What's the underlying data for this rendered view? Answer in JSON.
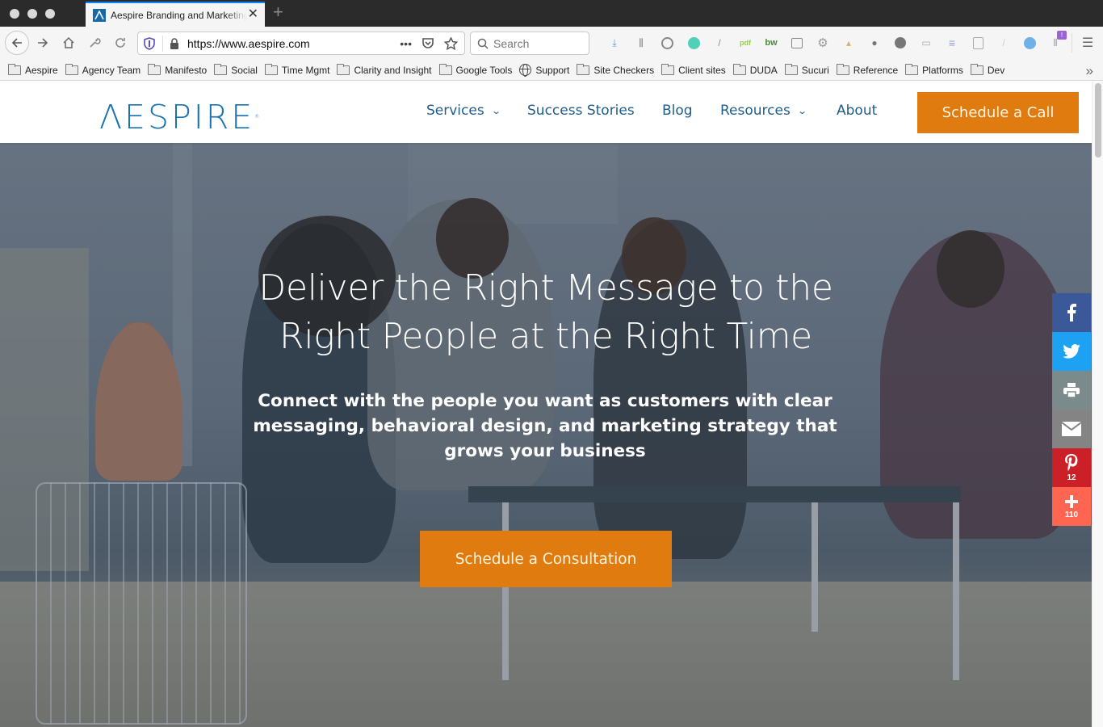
{
  "browser": {
    "tab": {
      "title": "Aespire Branding and Marketing"
    },
    "url": "https://www.aespire.com",
    "url_actions": "•••",
    "search_placeholder": "Search",
    "bookmarks": [
      {
        "label": "Aespire",
        "icon": "folder-icon"
      },
      {
        "label": "Agency Team",
        "icon": "folder-icon"
      },
      {
        "label": "Manifesto",
        "icon": "folder-icon"
      },
      {
        "label": "Social",
        "icon": "folder-icon"
      },
      {
        "label": "Time Mgmt",
        "icon": "folder-icon"
      },
      {
        "label": "Clarity and Insight",
        "icon": "folder-icon"
      },
      {
        "label": "Google Tools",
        "icon": "folder-icon"
      },
      {
        "label": "Support",
        "icon": "globe-icon"
      },
      {
        "label": "Site Checkers",
        "icon": "folder-icon"
      },
      {
        "label": "Client sites",
        "icon": "folder-icon"
      },
      {
        "label": "DUDA",
        "icon": "folder-icon"
      },
      {
        "label": "Sucuri",
        "icon": "folder-icon"
      },
      {
        "label": "Reference",
        "icon": "folder-icon"
      },
      {
        "label": "Platforms",
        "icon": "folder-icon"
      },
      {
        "label": "Dev",
        "icon": "folder-icon"
      }
    ],
    "extension_badge": "!"
  },
  "site": {
    "logo": "ΛESPIRE",
    "logo_mark": "®",
    "nav": [
      {
        "label": "Services",
        "has_dropdown": true
      },
      {
        "label": "Success Stories",
        "has_dropdown": false
      },
      {
        "label": "Blog",
        "has_dropdown": false
      },
      {
        "label": "Resources",
        "has_dropdown": true
      },
      {
        "label": "About",
        "has_dropdown": false
      }
    ],
    "cta_call": "Schedule a Call",
    "hero": {
      "headline_line1": "Deliver the Right Message to the",
      "headline_line2": "Right People at the Right Time",
      "subheading": "Connect with the people you want as customers with clear messaging, behavioral design, and marketing strategy that grows your business",
      "cta": "Schedule a Consultation"
    },
    "share": [
      {
        "network": "facebook",
        "icon": "facebook-icon",
        "color": "#3b5998",
        "count": ""
      },
      {
        "network": "twitter",
        "icon": "twitter-icon",
        "color": "#1da1f2",
        "count": ""
      },
      {
        "network": "print",
        "icon": "print-icon",
        "color": "#7b8a8b",
        "count": ""
      },
      {
        "network": "email",
        "icon": "email-icon",
        "color": "#848484",
        "count": ""
      },
      {
        "network": "pinterest",
        "icon": "pinterest-icon",
        "color": "#cb2027",
        "count": "12"
      },
      {
        "network": "more",
        "icon": "plus-icon",
        "color": "#ff6550",
        "count": "110"
      }
    ],
    "colors": {
      "brand_blue": "#1a73b0",
      "nav_text": "#1f5e8a",
      "cta_orange": "#e07b0f"
    }
  }
}
